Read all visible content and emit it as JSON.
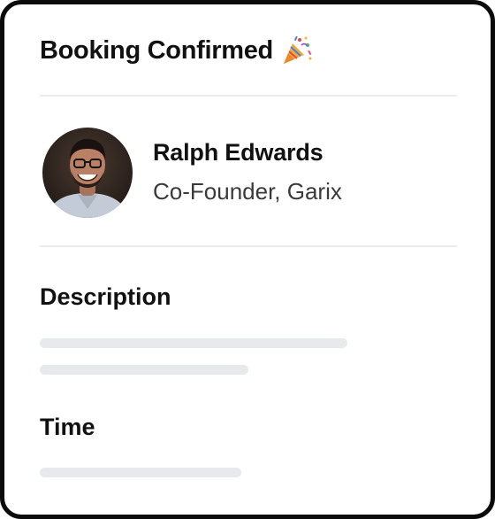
{
  "card": {
    "title": "Booking Confirmed",
    "title_icon": "party-popper-icon"
  },
  "person": {
    "name": "Ralph Edwards",
    "role": "Co-Founder, Garix",
    "avatar_icon": "avatar-photo"
  },
  "sections": {
    "description_label": "Description",
    "time_label": "Time"
  },
  "placeholders": {
    "description_line_count": 2,
    "time_line_count": 1
  },
  "colors": {
    "border": "#0b0b0b",
    "skeleton": "#e7e9ec",
    "divider": "#ececec"
  }
}
